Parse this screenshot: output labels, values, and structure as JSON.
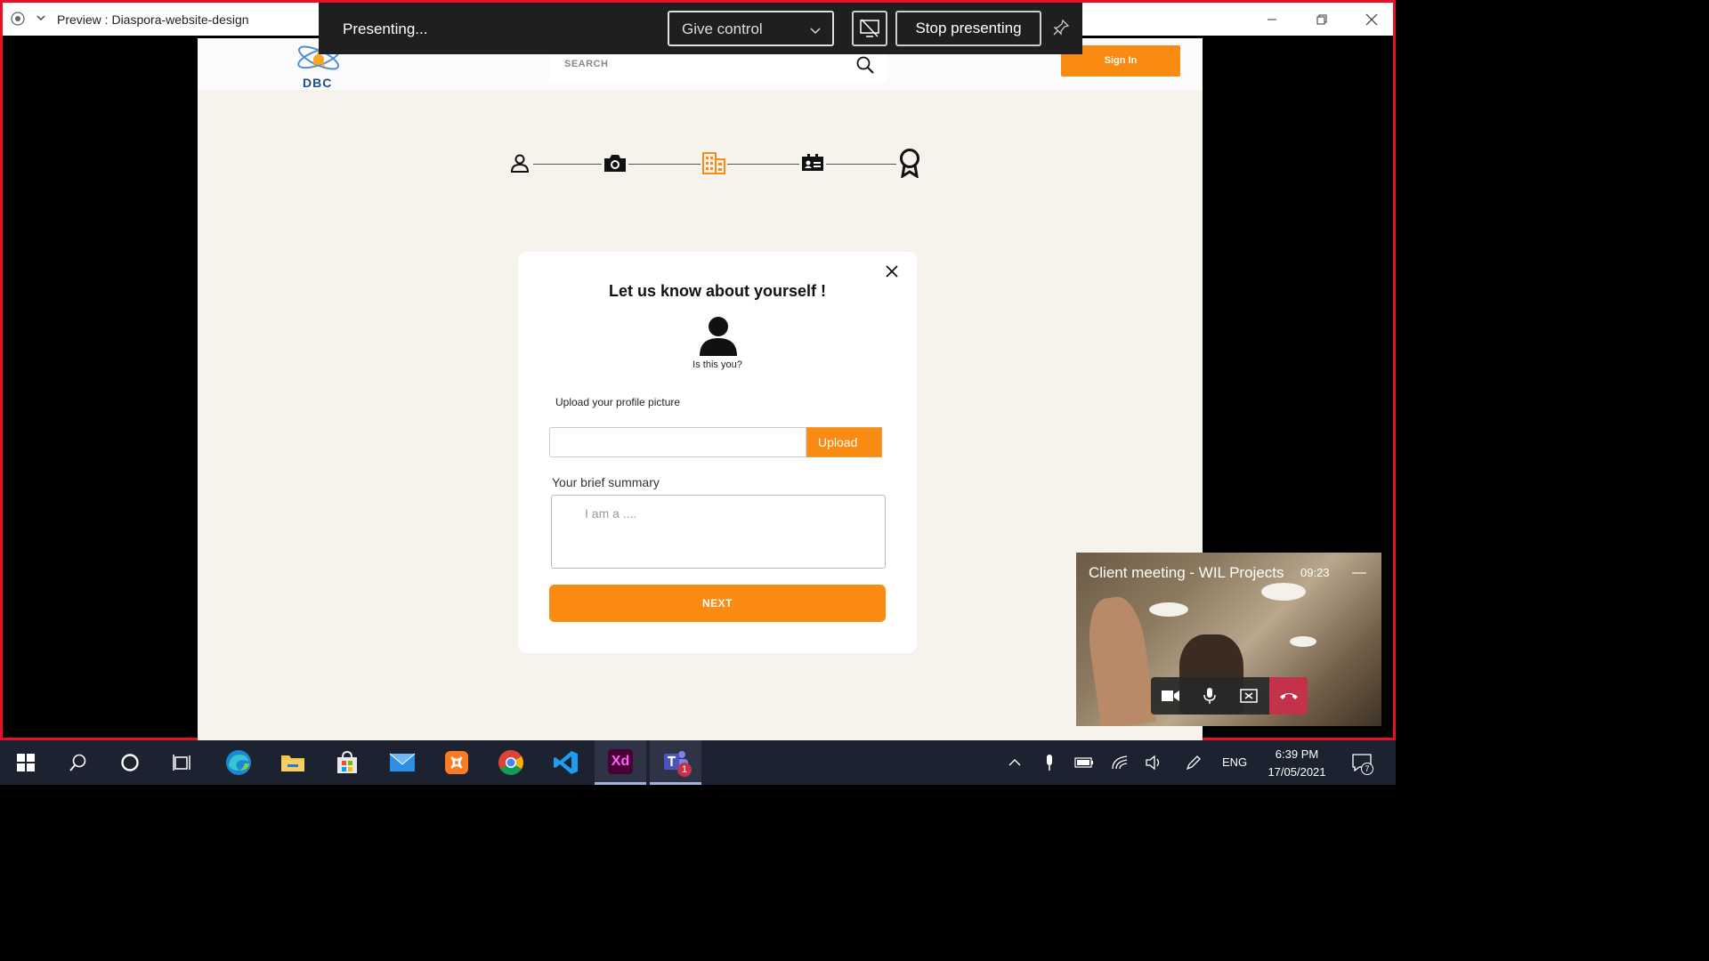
{
  "window": {
    "title": "Preview : Diaspora-website-design"
  },
  "presenting_bar": {
    "status": "Presenting...",
    "give_control": "Give control",
    "stop_presenting": "Stop presenting"
  },
  "site": {
    "logo_text": "DBC",
    "search_placeholder": "SEARCH",
    "signin_label": "Sign In",
    "steps": [
      "person-icon",
      "camera-icon",
      "building-icon",
      "id-card-icon",
      "award-ribbon-icon"
    ],
    "active_step": 3,
    "accent_color": "#f98a12",
    "modal": {
      "heading": "Let us know about yourself !",
      "avatar_caption": "Is this you?",
      "upload_label": "Upload your profile picture",
      "upload_button": "Upload",
      "summary_label": "Your brief summary",
      "summary_placeholder": "I am a ....",
      "next_button": "NEXT"
    }
  },
  "meeting": {
    "title": "Client meeting - WIL Projects",
    "elapsed": "09:23"
  },
  "taskbar": {
    "apps": [
      "windows-start-icon",
      "search-icon",
      "cortana-icon",
      "task-view-icon",
      "edge-icon",
      "file-explorer-icon",
      "store-icon",
      "mail-icon",
      "xampp-icon",
      "chrome-icon",
      "vscode-icon",
      "adobe-xd-icon",
      "teams-icon"
    ],
    "xd_label": "Xd",
    "teams_badge": "1",
    "language": "ENG",
    "time": "6:39 PM",
    "date": "17/05/2021",
    "notifications_count": "7"
  }
}
